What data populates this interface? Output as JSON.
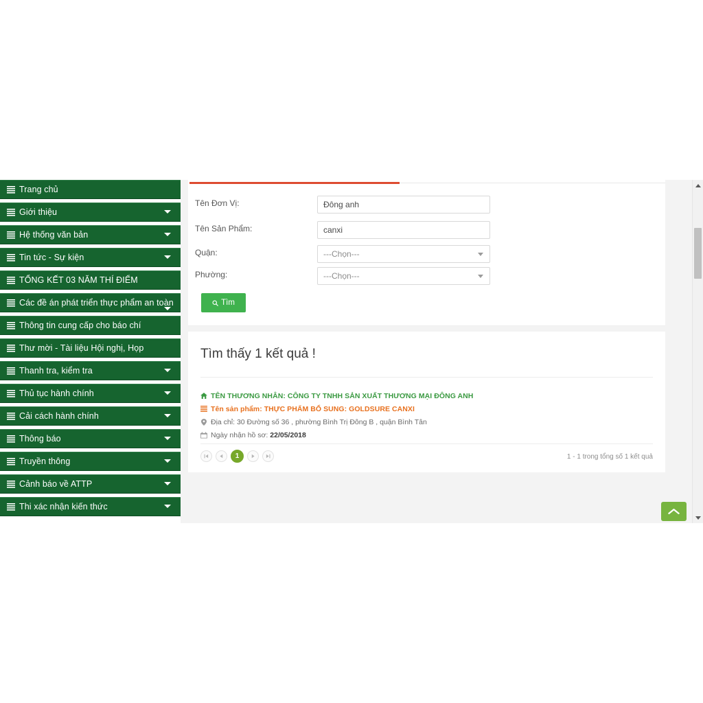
{
  "theme": {
    "sidebar_green": "#16642f",
    "accent_red": "#dd4b30",
    "button_green": "#3fb24e",
    "pager_green": "#77a82a",
    "merchant_green": "#3b9a42",
    "product_orange": "#e8711f",
    "scrolltop_green": "#77b43f"
  },
  "sidebar": {
    "items": [
      {
        "label": "Trang chủ",
        "icon": "list-icon",
        "caret": false
      },
      {
        "label": "Giới thiệu",
        "icon": "list-icon",
        "caret": true
      },
      {
        "label": "Hệ thống văn bản",
        "icon": "list-icon",
        "caret": true
      },
      {
        "label": "Tin tức - Sự kiện",
        "icon": "list-icon",
        "caret": true
      },
      {
        "label": "TỔNG KẾT 03 NĂM THÍ ĐIỂM",
        "icon": "list-icon",
        "caret": false
      },
      {
        "label": "Các đề án phát triển thực phẩm an toàn",
        "icon": "list-icon",
        "caret": true
      },
      {
        "label": "Thông tin cung cấp cho báo chí",
        "icon": "list-icon",
        "caret": false
      },
      {
        "label": "Thư mời - Tài liệu Hội nghị, Họp",
        "icon": "list-icon",
        "caret": false
      },
      {
        "label": "Thanh tra, kiểm tra",
        "icon": "list-icon",
        "caret": true
      },
      {
        "label": "Thủ tục hành chính",
        "icon": "list-icon",
        "caret": true
      },
      {
        "label": "Cải cách hành chính",
        "icon": "list-icon",
        "caret": true
      },
      {
        "label": "Thông báo",
        "icon": "list-icon",
        "caret": true
      },
      {
        "label": "Truyền thông",
        "icon": "list-icon",
        "caret": true
      },
      {
        "label": "Cảnh báo về ATTP",
        "icon": "list-icon",
        "caret": true
      },
      {
        "label": "Thi xác nhận kiến thức",
        "icon": "list-icon",
        "caret": true
      }
    ]
  },
  "search_form": {
    "fields": [
      {
        "label": "Tên Đơn Vị:",
        "value": "Đông anh",
        "type": "text"
      },
      {
        "label": "Tên Sản Phẩm:",
        "value": "canxi",
        "type": "text"
      },
      {
        "label": "Quận:",
        "value": "---Chọn---",
        "type": "select"
      },
      {
        "label": "Phường:",
        "value": "---Chọn---",
        "type": "select"
      }
    ],
    "submit_label": "Tìm",
    "submit_icon": "search-icon"
  },
  "results": {
    "title": "Tìm thấy 1 kết quả !",
    "items": [
      {
        "merchant": "TÊN THƯƠNG NHÂN: CÔNG TY TNHH SẢN XUẤT THƯƠNG MẠI ĐÔNG ANH",
        "merchant_icon": "home-icon",
        "product": "Tên sản phẩm: THỰC PHẨM BỔ SUNG: GOLDSURE CANXI",
        "product_icon": "list-icon",
        "address_label": "Địa chỉ:",
        "address_value": "30 Đường số 36 , phường Bình Trị Đông B , quận Bình Tân",
        "address_icon": "map-pin-icon",
        "date_label": "Ngày nhận hồ sơ:",
        "date_value": "22/05/2018",
        "date_icon": "calendar-icon"
      }
    ],
    "pager": {
      "first_label": "|◄",
      "prev_label": "◄",
      "current_page": "1",
      "next_label": "►",
      "last_label": "►|",
      "info": "1 - 1 trong tổng số 1 kết quả"
    }
  },
  "scroll_top": {
    "icon": "chevron-up-icon",
    "label": ""
  },
  "scrollbar": {
    "up_icon": "scroll-up-arrow",
    "down_icon": "scroll-down-arrow"
  }
}
